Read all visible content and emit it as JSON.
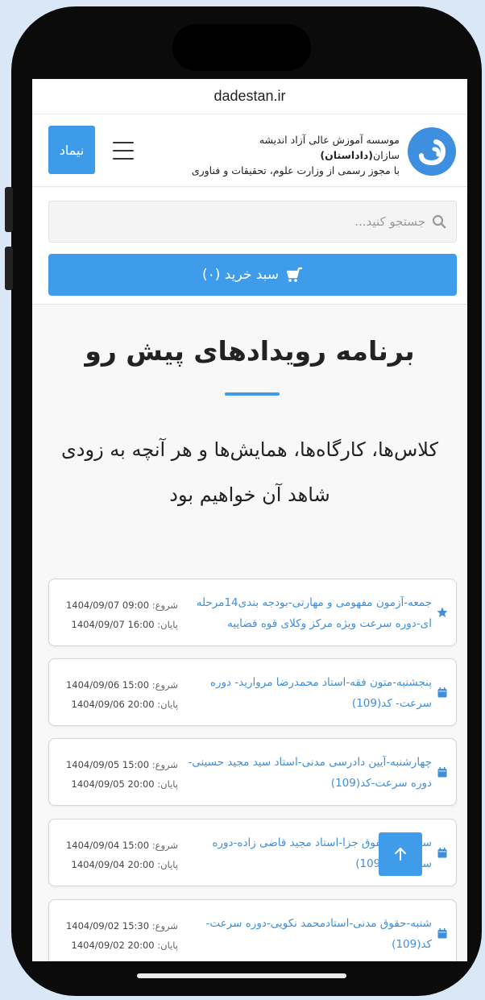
{
  "browser": {
    "url": "dadestan.ir"
  },
  "header": {
    "brand_prefix": "موسسه آموزش عالی آزاد اندیشه سازان",
    "brand_name": "(داداستان)",
    "brand_line2": "با مجوز رسمی از وزارت علوم، تحقیقات و فناوری",
    "nimad_label": "نیماد",
    "logo_icon": "dadestan-logo-icon",
    "menu_icon": "hamburger-menu-icon"
  },
  "search": {
    "placeholder": "جستجو کنید...",
    "value": ""
  },
  "cart": {
    "label": "سبد خرید (۰)",
    "icon": "shopping-cart-icon"
  },
  "hero": {
    "title": "برنامه رویدادهای پیش رو",
    "subtitle": "کلاس‌ها، کارگاه‌ها، همایش‌ها و هر آنچه به زودی شاهد آن خواهیم بود"
  },
  "events": [
    {
      "icon": "star-icon",
      "title": "جمعه-آزمون مفهومی و مهارتی-بودجه بندی14مرحله ای-دوره سرعت ویژه مرکز وکلای قوه قضاییه",
      "start_label": "شروع:",
      "start": "09:00 1404/09/07",
      "end_label": "پایان:",
      "end": "16:00 1404/09/07"
    },
    {
      "icon": "calendar-icon",
      "title": "پنجشنبه-متون فقه-استاد محمدرضا مروارید- دوره سرعت- کد(109)",
      "start_label": "شروع:",
      "start": "15:00 1404/09/06",
      "end_label": "پایان:",
      "end": "20:00 1404/09/06"
    },
    {
      "icon": "calendar-icon",
      "title": "چهارشنبه-آیین دادرسی مدنی-استاد سید مجید حسینی-دوره سرعت-کد(109)",
      "start_label": "شروع:",
      "start": "15:00 1404/09/05",
      "end_label": "پایان:",
      "end": "20:00 1404/09/05"
    },
    {
      "icon": "calendar-icon",
      "title": "سه شنبه-حقوق جزا-استاد مجید قاضی زاده-دوره سرعت-کد(109)",
      "start_label": "شروع:",
      "start": "15:00 1404/09/04",
      "end_label": "پایان:",
      "end": "20:00 1404/09/04"
    },
    {
      "icon": "calendar-icon",
      "title": "شنبه-حقوق مدنی-استادمحمد نکویی-دوره سرعت-کد(109)",
      "start_label": "شروع:",
      "start": "15:30 1404/09/02",
      "end_label": "پایان:",
      "end": "20:00 1404/09/02"
    }
  ],
  "scroll_top": {
    "icon": "arrow-up-icon"
  },
  "colors": {
    "accent": "#3f9cea",
    "link": "#3f8fd8",
    "frame": "#0b0b0b",
    "background": "#d9e7f7"
  }
}
